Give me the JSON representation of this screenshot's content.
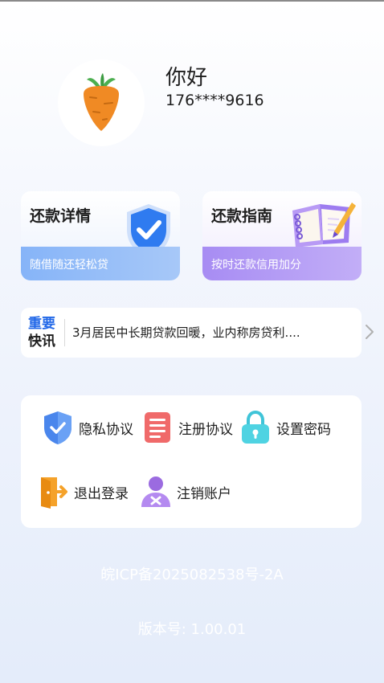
{
  "profile": {
    "greeting": "你好",
    "phone": "176****9616",
    "avatar_icon": "carrot-icon"
  },
  "cards": [
    {
      "title": "还款详情",
      "subtitle": "随借随还轻松贷",
      "icon": "shield-check-icon",
      "accent": "#86b4f8"
    },
    {
      "title": "还款指南",
      "subtitle": "按时还款信用加分",
      "icon": "notebook-pen-icon",
      "accent": "#a78cf3"
    }
  ],
  "news": {
    "tag_line1": "重要",
    "tag_line2": "快讯",
    "text": "3月居民中长期贷款回暖，业内称房贷利....",
    "chevron_icon": "chevron-right-icon"
  },
  "settings": {
    "privacy": "隐私协议",
    "register": "注册协议",
    "password": "设置密码",
    "logout": "退出登录",
    "cancel_account": "注销账户"
  },
  "footer": {
    "icp": "皖ICP备2025082538号-2A",
    "version": "版本号: 1.00.01"
  },
  "colors": {
    "brand_blue": "#2268e8",
    "card_blue": "#86b4f8",
    "card_purple": "#a78cf3"
  }
}
